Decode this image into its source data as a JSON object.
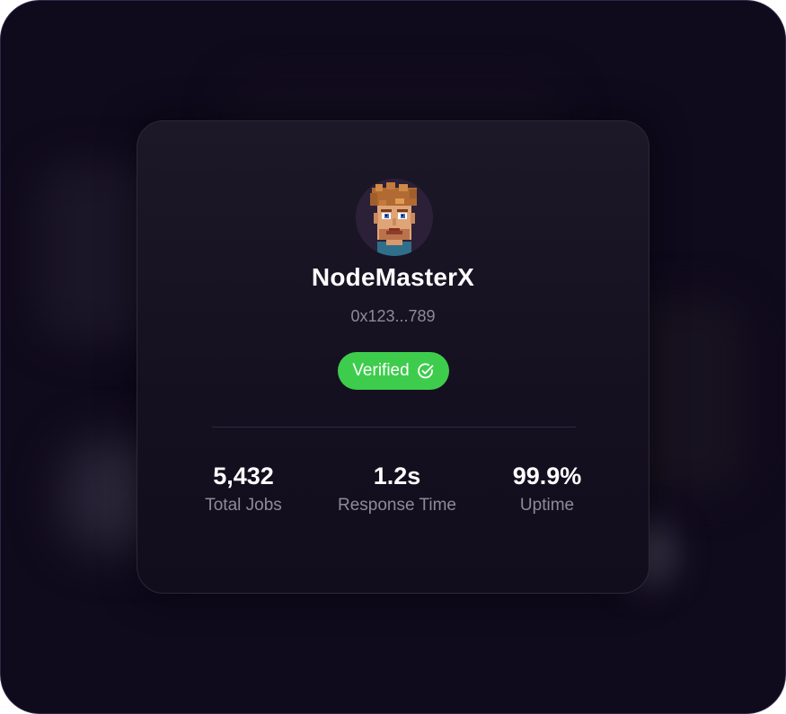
{
  "profile": {
    "name": "NodeMasterX",
    "address": "0x123...789",
    "avatar_icon": "pixel-art-avatar"
  },
  "badge": {
    "label": "Verified",
    "icon": "check-circle-icon",
    "color": "#3ecc4d"
  },
  "stats": [
    {
      "value": "5,432",
      "label": "Total Jobs"
    },
    {
      "value": "1.2s",
      "label": "Response Time"
    },
    {
      "value": "99.9%",
      "label": "Uptime"
    }
  ],
  "colors": {
    "background": "#0f0a1c",
    "card": "#1a1626",
    "text_primary": "#ffffff",
    "text_secondary": "#8e8a99"
  }
}
